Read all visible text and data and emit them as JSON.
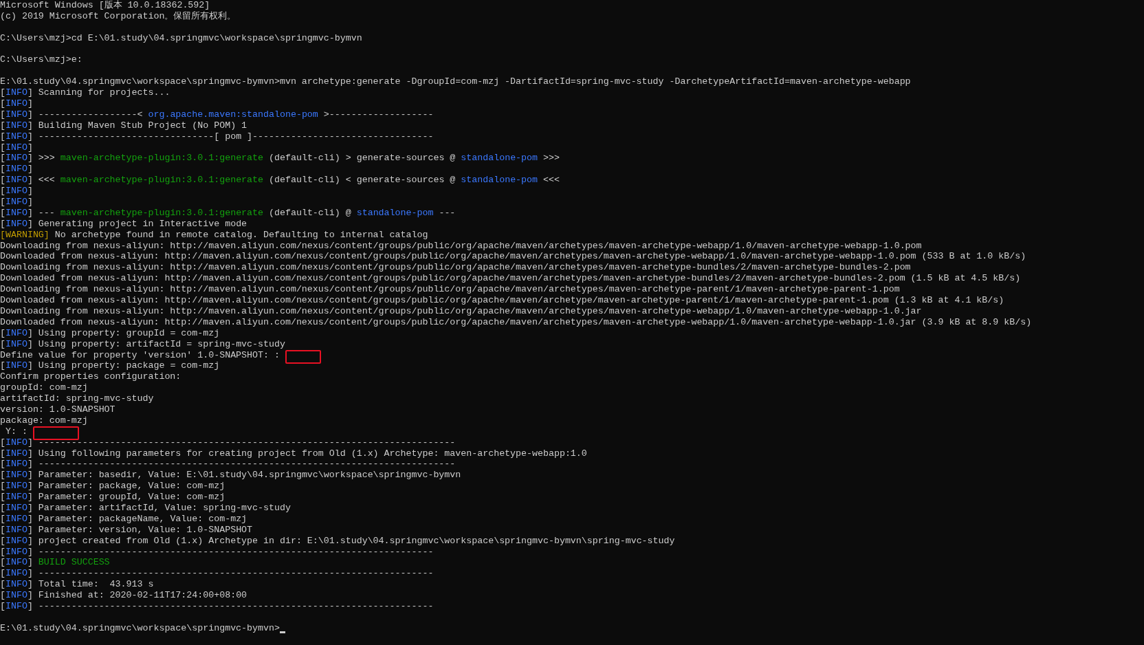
{
  "console": {
    "lines": [
      {
        "kind": "plain",
        "text": "Microsoft Windows [版本 10.0.18362.592]"
      },
      {
        "kind": "plain",
        "text": "(c) 2019 Microsoft Corporation。保留所有权利。"
      },
      {
        "kind": "blank"
      },
      {
        "kind": "plain",
        "text": "C:\\Users\\mzj>cd E:\\01.study\\04.springmvc\\workspace\\springmvc-bymvn"
      },
      {
        "kind": "blank"
      },
      {
        "kind": "plain",
        "text": "C:\\Users\\mzj>e:"
      },
      {
        "kind": "blank"
      },
      {
        "kind": "plain",
        "text": "E:\\01.study\\04.springmvc\\workspace\\springmvc-bymvn>mvn archetype:generate -DgroupId=com-mzj -DartifactId=spring-mvc-study -DarchetypeArtifactId=maven-archetype-webapp"
      },
      {
        "kind": "info",
        "tag": [
          "[",
          "INFO",
          "]"
        ],
        "text": " Scanning for projects..."
      },
      {
        "kind": "info",
        "tag": [
          "[",
          "INFO",
          "]"
        ]
      },
      {
        "kind": "info",
        "tag": [
          "[",
          "INFO",
          "]"
        ],
        "parts": [
          {
            "text": " ------------------< ",
            "kind": "plain"
          },
          {
            "text": "org.apache.maven:standalone-pom",
            "kind": "blue"
          },
          {
            "text": " >-------------------",
            "kind": "plain"
          }
        ]
      },
      {
        "kind": "info",
        "tag": [
          "[",
          "INFO",
          "]"
        ],
        "text": " Building Maven Stub Project (No POM) 1"
      },
      {
        "kind": "info",
        "tag": [
          "[",
          "INFO",
          "]"
        ],
        "text": " --------------------------------[ pom ]---------------------------------"
      },
      {
        "kind": "info",
        "tag": [
          "[",
          "INFO",
          "]"
        ]
      },
      {
        "kind": "info",
        "tag": [
          "[",
          "INFO",
          "]"
        ],
        "parts": [
          {
            "text": " >>> ",
            "kind": "plain"
          },
          {
            "text": "maven-archetype-plugin:3.0.1:generate",
            "kind": "green"
          },
          {
            "text": " (default-cli) > generate-sources @ ",
            "kind": "plain"
          },
          {
            "text": "standalone-pom",
            "kind": "blue"
          },
          {
            "text": " >>>",
            "kind": "plain"
          }
        ]
      },
      {
        "kind": "info",
        "tag": [
          "[",
          "INFO",
          "]"
        ]
      },
      {
        "kind": "info",
        "tag": [
          "[",
          "INFO",
          "]"
        ],
        "parts": [
          {
            "text": " <<< ",
            "kind": "plain"
          },
          {
            "text": "maven-archetype-plugin:3.0.1:generate",
            "kind": "green"
          },
          {
            "text": " (default-cli) < generate-sources @ ",
            "kind": "plain"
          },
          {
            "text": "standalone-pom",
            "kind": "blue"
          },
          {
            "text": " <<<",
            "kind": "plain"
          }
        ]
      },
      {
        "kind": "info",
        "tag": [
          "[",
          "INFO",
          "]"
        ]
      },
      {
        "kind": "info",
        "tag": [
          "[",
          "INFO",
          "]"
        ]
      },
      {
        "kind": "info",
        "tag": [
          "[",
          "INFO",
          "]"
        ],
        "parts": [
          {
            "text": " --- ",
            "kind": "plain"
          },
          {
            "text": "maven-archetype-plugin:3.0.1:generate",
            "kind": "green"
          },
          {
            "text": " (default-cli) @ ",
            "kind": "plain"
          },
          {
            "text": "standalone-pom",
            "kind": "blue"
          },
          {
            "text": " ---",
            "kind": "plain"
          }
        ]
      },
      {
        "kind": "info",
        "tag": [
          "[",
          "INFO",
          "]"
        ],
        "text": " Generating project in Interactive mode"
      },
      {
        "kind": "warning",
        "tag": [
          "[",
          "WARNING",
          "]"
        ],
        "text": " No archetype found in remote catalog. Defaulting to internal catalog"
      },
      {
        "kind": "plain",
        "text": "Downloading from nexus-aliyun: http://maven.aliyun.com/nexus/content/groups/public/org/apache/maven/archetypes/maven-archetype-webapp/1.0/maven-archetype-webapp-1.0.pom"
      },
      {
        "kind": "plain",
        "text": "Downloaded from nexus-aliyun: http://maven.aliyun.com/nexus/content/groups/public/org/apache/maven/archetypes/maven-archetype-webapp/1.0/maven-archetype-webapp-1.0.pom (533 B at 1.0 kB/s)"
      },
      {
        "kind": "plain",
        "text": "Downloading from nexus-aliyun: http://maven.aliyun.com/nexus/content/groups/public/org/apache/maven/archetypes/maven-archetype-bundles/2/maven-archetype-bundles-2.pom"
      },
      {
        "kind": "plain",
        "text": "Downloaded from nexus-aliyun: http://maven.aliyun.com/nexus/content/groups/public/org/apache/maven/archetypes/maven-archetype-bundles/2/maven-archetype-bundles-2.pom (1.5 kB at 4.5 kB/s)"
      },
      {
        "kind": "plain",
        "text": "Downloading from nexus-aliyun: http://maven.aliyun.com/nexus/content/groups/public/org/apache/maven/archetypes/maven-archetype-parent/1/maven-archetype-parent-1.pom"
      },
      {
        "kind": "plain",
        "text": "Downloaded from nexus-aliyun: http://maven.aliyun.com/nexus/content/groups/public/org/apache/maven/archetype/maven-archetype-parent/1/maven-archetype-parent-1.pom (1.3 kB at 4.1 kB/s)"
      },
      {
        "kind": "plain",
        "text": "Downloading from nexus-aliyun: http://maven.aliyun.com/nexus/content/groups/public/org/apache/maven/archetypes/maven-archetype-webapp/1.0/maven-archetype-webapp-1.0.jar"
      },
      {
        "kind": "plain",
        "text": "Downloaded from nexus-aliyun: http://maven.aliyun.com/nexus/content/groups/public/org/apache/maven/archetypes/maven-archetype-webapp/1.0/maven-archetype-webapp-1.0.jar (3.9 kB at 8.9 kB/s)"
      },
      {
        "kind": "info",
        "tag": [
          "[",
          "INFO",
          "]"
        ],
        "text": " Using property: groupId = com-mzj"
      },
      {
        "kind": "info",
        "tag": [
          "[",
          "INFO",
          "]"
        ],
        "text": " Using property: artifactId = spring-mvc-study"
      },
      {
        "kind": "plain",
        "text": "Define value for property 'version' 1.0-SNAPSHOT: :",
        "marker": {
          "kind": "narrow"
        }
      },
      {
        "kind": "info",
        "tag": [
          "[",
          "INFO",
          "]"
        ],
        "text": " Using property: package = com-mzj"
      },
      {
        "kind": "plain",
        "text": "Confirm properties configuration:"
      },
      {
        "kind": "plain",
        "text": "groupId: com-mzj"
      },
      {
        "kind": "plain",
        "text": "artifactId: spring-mvc-study"
      },
      {
        "kind": "plain",
        "text": "version: 1.0-SNAPSHOT"
      },
      {
        "kind": "plain",
        "text": "package: com-mzj"
      },
      {
        "kind": "plain",
        "text": " Y: :",
        "marker": {
          "kind": "wide"
        }
      },
      {
        "kind": "info",
        "tag": [
          "[",
          "INFO",
          "]"
        ],
        "text": " ----------------------------------------------------------------------------"
      },
      {
        "kind": "info",
        "tag": [
          "[",
          "INFO",
          "]"
        ],
        "text": " Using following parameters for creating project from Old (1.x) Archetype: maven-archetype-webapp:1.0"
      },
      {
        "kind": "info",
        "tag": [
          "[",
          "INFO",
          "]"
        ],
        "text": " ----------------------------------------------------------------------------"
      },
      {
        "kind": "info",
        "tag": [
          "[",
          "INFO",
          "]"
        ],
        "text": " Parameter: basedir, Value: E:\\01.study\\04.springmvc\\workspace\\springmvc-bymvn"
      },
      {
        "kind": "info",
        "tag": [
          "[",
          "INFO",
          "]"
        ],
        "text": " Parameter: package, Value: com-mzj"
      },
      {
        "kind": "info",
        "tag": [
          "[",
          "INFO",
          "]"
        ],
        "text": " Parameter: groupId, Value: com-mzj"
      },
      {
        "kind": "info",
        "tag": [
          "[",
          "INFO",
          "]"
        ],
        "text": " Parameter: artifactId, Value: spring-mvc-study"
      },
      {
        "kind": "info",
        "tag": [
          "[",
          "INFO",
          "]"
        ],
        "text": " Parameter: packageName, Value: com-mzj"
      },
      {
        "kind": "info",
        "tag": [
          "[",
          "INFO",
          "]"
        ],
        "text": " Parameter: version, Value: 1.0-SNAPSHOT"
      },
      {
        "kind": "info",
        "tag": [
          "[",
          "INFO",
          "]"
        ],
        "text": " project created from Old (1.x) Archetype in dir: E:\\01.study\\04.springmvc\\workspace\\springmvc-bymvn\\spring-mvc-study"
      },
      {
        "kind": "info",
        "tag": [
          "[",
          "INFO",
          "]"
        ],
        "text": " ------------------------------------------------------------------------"
      },
      {
        "kind": "info",
        "tag": [
          "[",
          "INFO",
          "]"
        ],
        "parts": [
          {
            "text": " BUILD SUCCESS",
            "kind": "green"
          }
        ]
      },
      {
        "kind": "info",
        "tag": [
          "[",
          "INFO",
          "]"
        ],
        "text": " ------------------------------------------------------------------------"
      },
      {
        "kind": "info",
        "tag": [
          "[",
          "INFO",
          "]"
        ],
        "text": " Total time:  43.913 s"
      },
      {
        "kind": "info",
        "tag": [
          "[",
          "INFO",
          "]"
        ],
        "text": " Finished at: 2020-02-11T17:24:00+08:00"
      },
      {
        "kind": "info",
        "tag": [
          "[",
          "INFO",
          "]"
        ],
        "text": " ------------------------------------------------------------------------"
      },
      {
        "kind": "blank"
      },
      {
        "kind": "plain",
        "text": "E:\\01.study\\04.springmvc\\workspace\\springmvc-bymvn>",
        "cursor": true
      }
    ]
  }
}
